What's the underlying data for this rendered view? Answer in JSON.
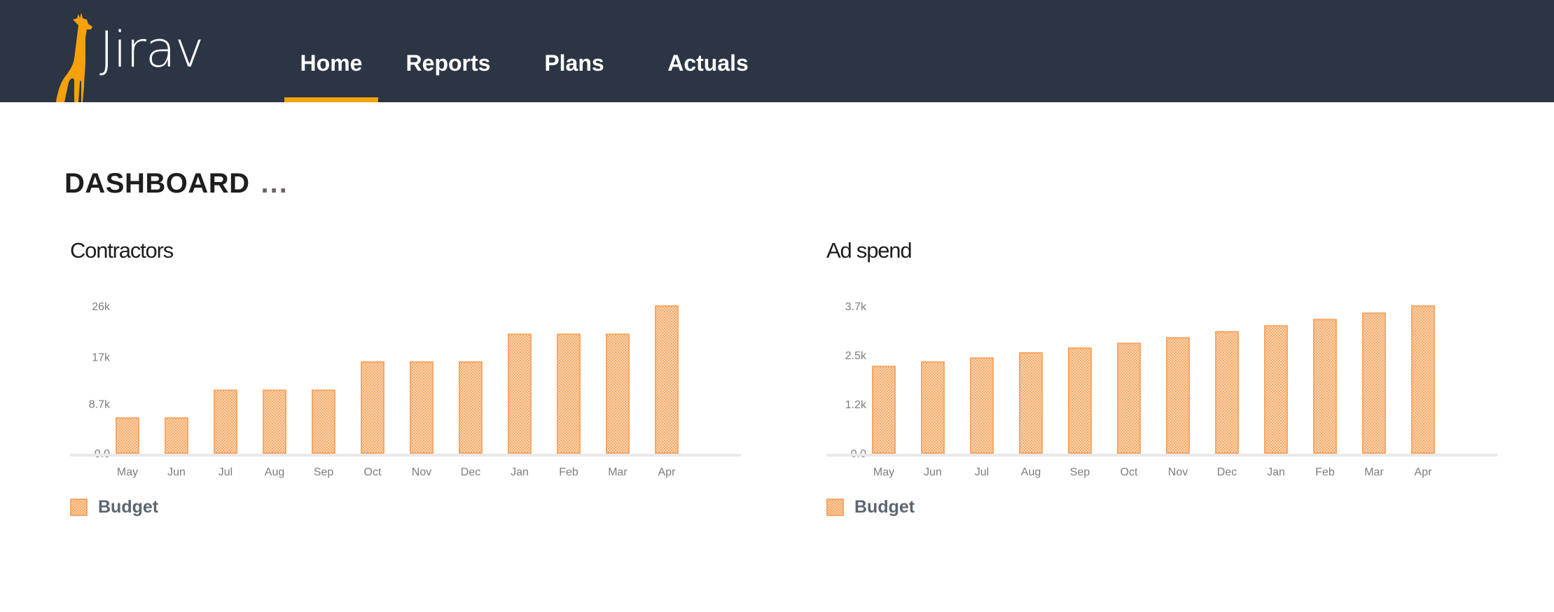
{
  "app": {
    "logo_text": "Jirav",
    "accent_color": "#f6a10a",
    "header_color": "#2b3544"
  },
  "nav": {
    "items": [
      {
        "label": "Home",
        "active": true
      },
      {
        "label": "Reports",
        "active": false
      },
      {
        "label": "Plans",
        "active": false
      },
      {
        "label": "Actuals",
        "active": false
      }
    ]
  },
  "page": {
    "title": "DASHBOARD",
    "more_label": "..."
  },
  "bar_color": "#f7a766",
  "chart_data": [
    {
      "type": "bar",
      "title": "Contractors",
      "xlabel": "",
      "ylabel": "",
      "categories": [
        "May",
        "Jun",
        "Jul",
        "Aug",
        "Sep",
        "Oct",
        "Nov",
        "Dec",
        "Jan",
        "Feb",
        "Mar",
        "Apr"
      ],
      "series": [
        {
          "name": "Budget",
          "values": [
            6200,
            6200,
            11100,
            11100,
            11100,
            16100,
            16100,
            16100,
            21000,
            21000,
            21000,
            26000
          ]
        }
      ],
      "yticks": [
        0,
        8700,
        17000,
        26000
      ],
      "ytick_labels": [
        "0.0",
        "8.7k",
        "17k",
        "26k"
      ],
      "ylim": [
        0,
        26000
      ],
      "grid": false,
      "legend": {
        "entries": [
          "Budget"
        ],
        "placement": "bottom-left"
      }
    },
    {
      "type": "bar",
      "title": "Ad spend",
      "xlabel": "",
      "ylabel": "",
      "categories": [
        "May",
        "Jun",
        "Jul",
        "Aug",
        "Sep",
        "Oct",
        "Nov",
        "Dec",
        "Jan",
        "Feb",
        "Mar",
        "Apr"
      ],
      "series": [
        {
          "name": "Budget",
          "values": [
            2180,
            2290,
            2390,
            2520,
            2640,
            2760,
            2900,
            3050,
            3200,
            3360,
            3520,
            3700
          ]
        }
      ],
      "yticks": [
        0,
        1233,
        2467,
        3700
      ],
      "ytick_labels": [
        "0.0",
        "1.2k",
        "2.5k",
        "3.7k"
      ],
      "ylim": [
        0,
        3700
      ],
      "grid": false,
      "legend": {
        "entries": [
          "Budget"
        ],
        "placement": "bottom-left"
      }
    }
  ]
}
